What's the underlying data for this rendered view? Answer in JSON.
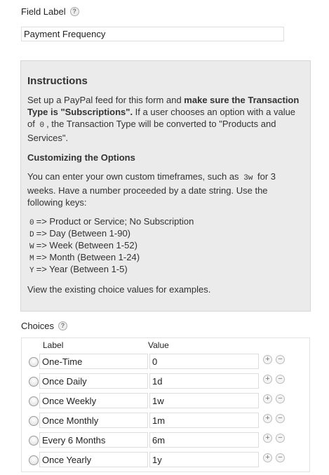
{
  "field_label": {
    "text": "Field Label",
    "help": "?"
  },
  "field_input_value": "Payment Frequency",
  "instructions": {
    "title": "Instructions",
    "p1_a": "Set up a PayPal feed for this form and ",
    "p1_bold": "make sure the Transaction Type is \"Subscriptions\".",
    "p1_b": " If a user chooses an option with a value of",
    "p1_code": "0",
    "p1_c": ", the Transaction Type will be converted to \"Products and Services\".",
    "subtitle": "Customizing the Options",
    "p2_a": "You can enter your own custom timeframes, such as",
    "p2_code": "3w",
    "p2_b": "for 3 weeks. Have a number proceeded by a date string. Use the following keys:",
    "keys": [
      {
        "key": "0",
        "desc": "=> Product or Service; No Subscription"
      },
      {
        "key": "D",
        "desc": "=> Day (Between 1-90)"
      },
      {
        "key": "W",
        "desc": "=> Week (Between 1-52)"
      },
      {
        "key": "M",
        "desc": "=> Month (Between 1-24)"
      },
      {
        "key": "Y",
        "desc": "=> Year (Between 1-5)"
      }
    ],
    "footer": "View the existing choice values for examples."
  },
  "choices": {
    "title": "Choices",
    "help": "?",
    "col_label": "Label",
    "col_value": "Value",
    "add_symbol": "+",
    "remove_symbol": "−",
    "rows": [
      {
        "label": "One-Time",
        "value": "0"
      },
      {
        "label": "Once Daily",
        "value": "1d"
      },
      {
        "label": "Once Weekly",
        "value": "1w"
      },
      {
        "label": "Once Monthly",
        "value": "1m"
      },
      {
        "label": "Every 6 Months",
        "value": "6m"
      },
      {
        "label": "Once Yearly",
        "value": "1y"
      }
    ]
  }
}
